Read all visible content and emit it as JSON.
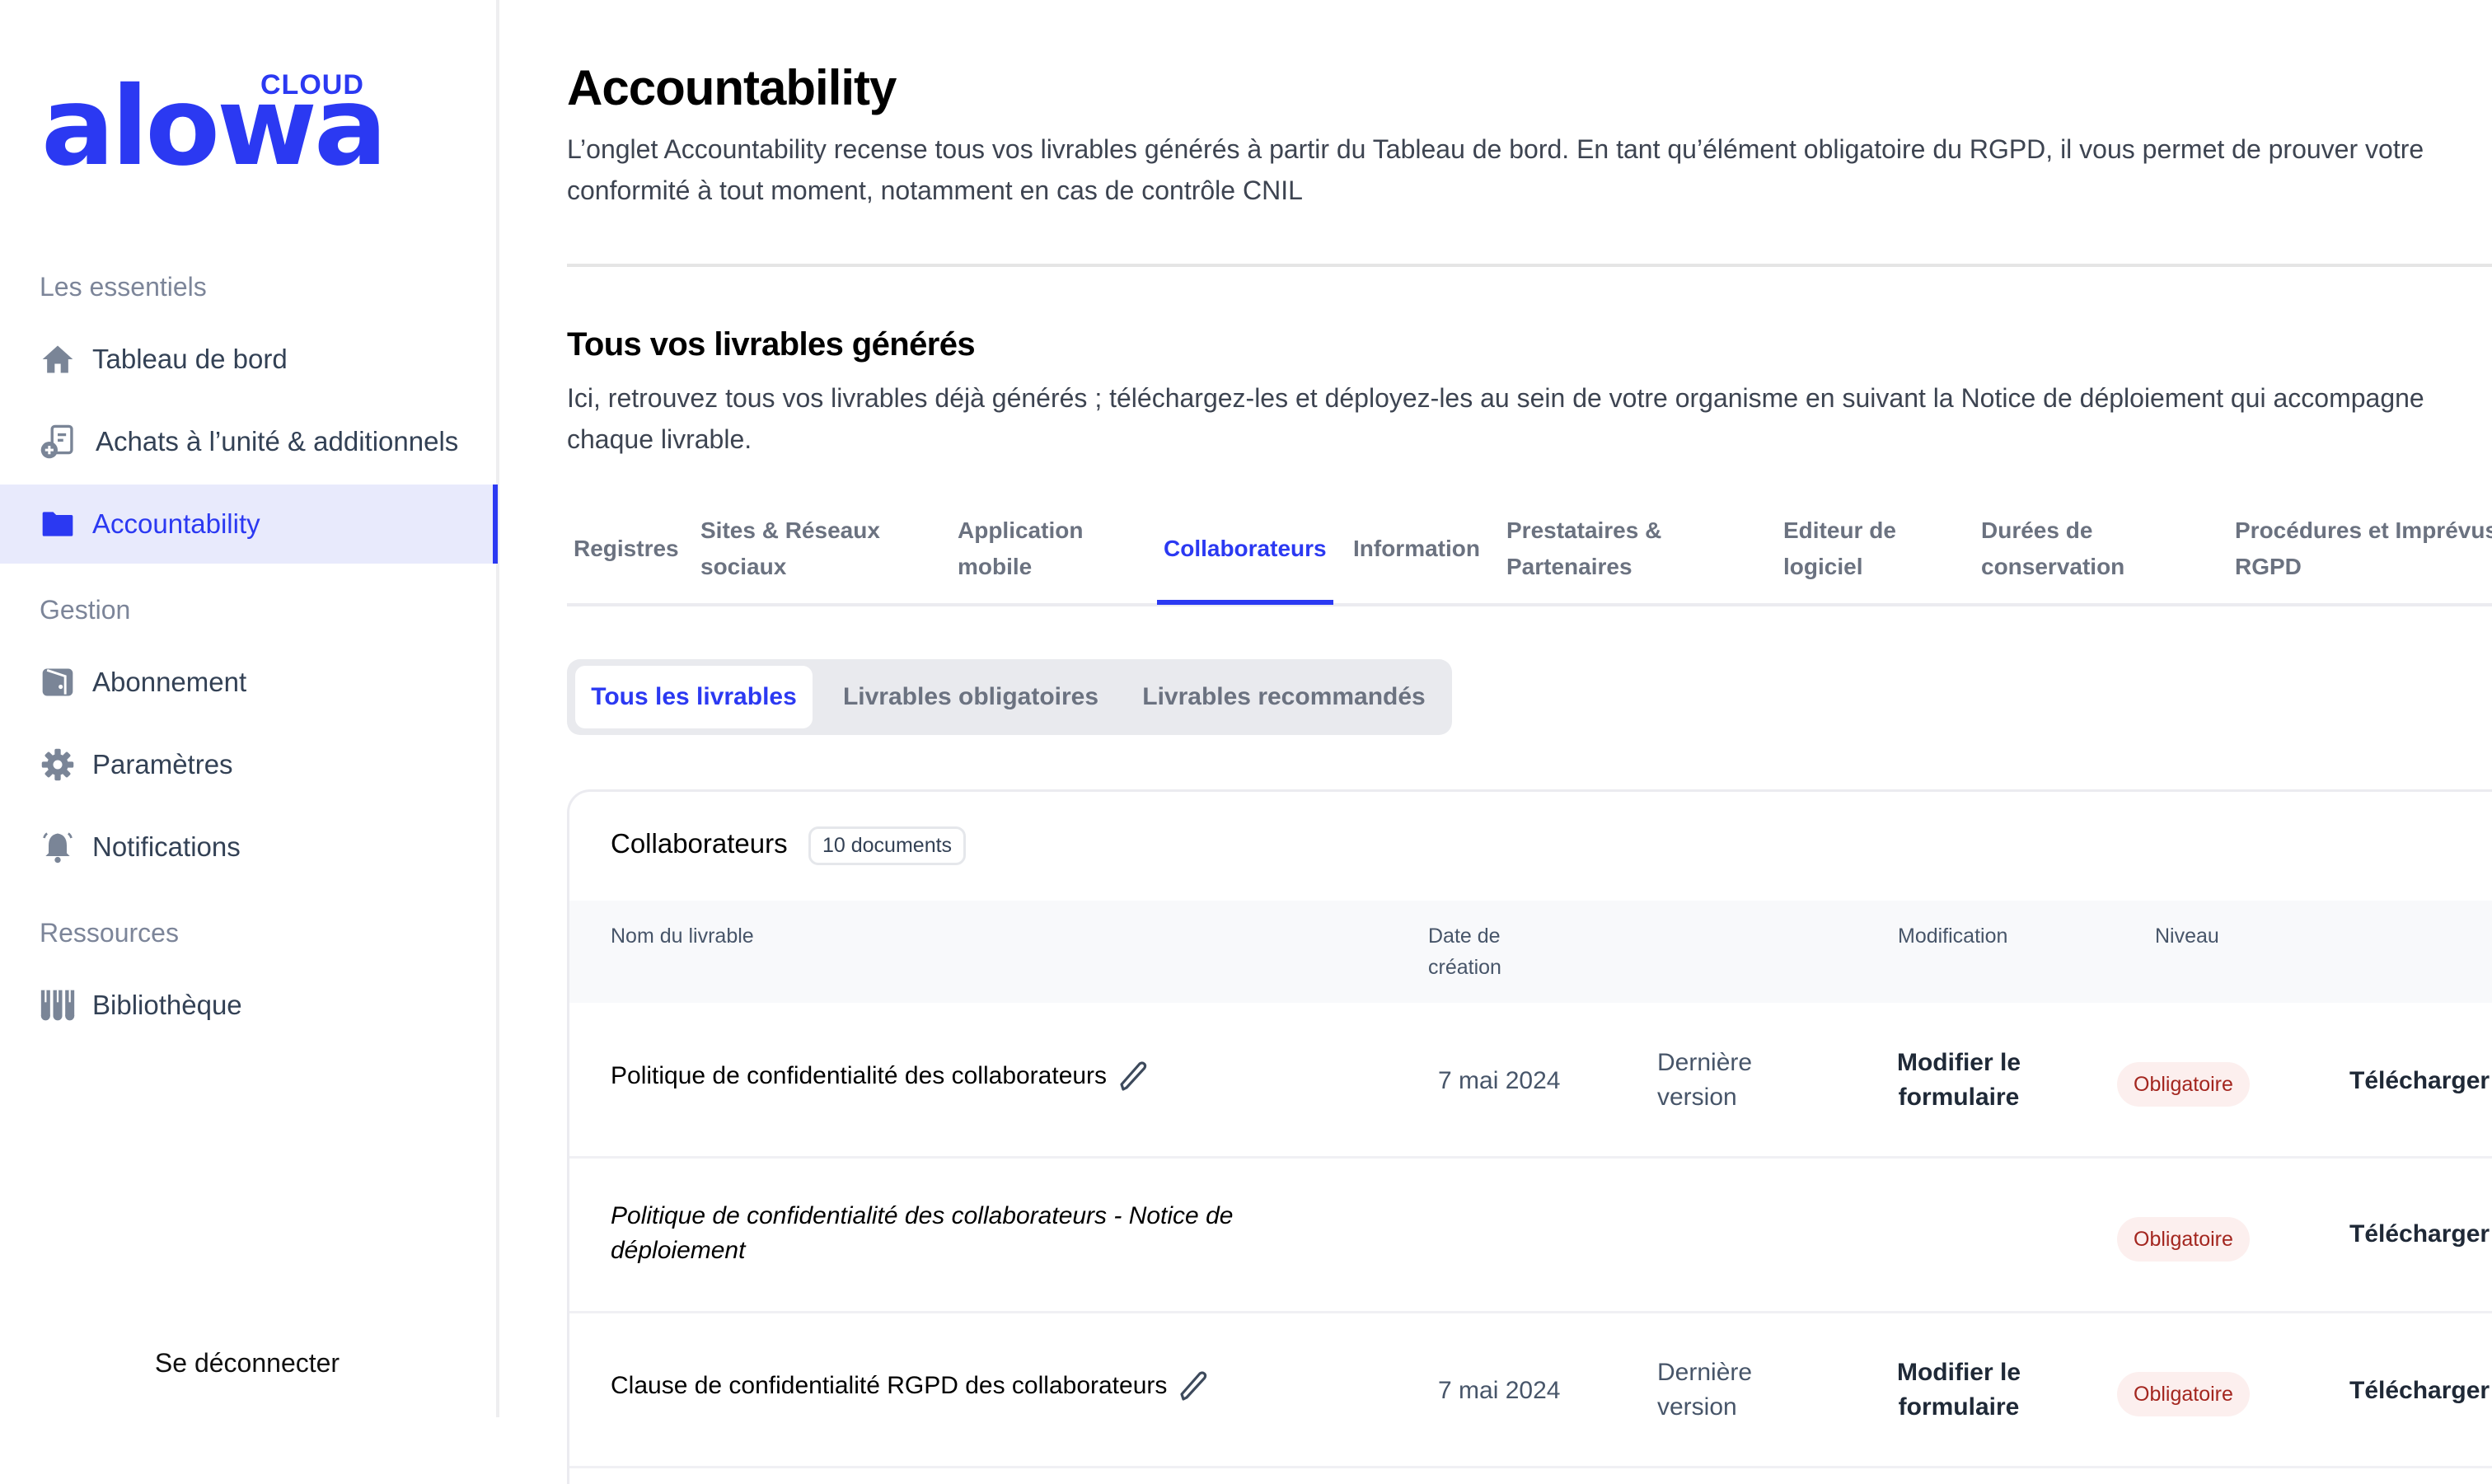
{
  "brand": {
    "name": "alowa",
    "suffix": "CLOUD",
    "accent": "#2b39f2"
  },
  "sidebar": {
    "sections": [
      {
        "title": "Les essentiels",
        "items": [
          {
            "label": "Tableau de bord",
            "icon": "home-icon"
          },
          {
            "label": "Achats à l’unité & additionnels",
            "icon": "document-add-icon"
          },
          {
            "label": "Accountability",
            "icon": "folder-icon",
            "active": true
          }
        ]
      },
      {
        "title": "Gestion",
        "items": [
          {
            "label": "Abonnement",
            "icon": "wallet-icon"
          },
          {
            "label": "Paramètres",
            "icon": "gear-icon"
          },
          {
            "label": "Notifications",
            "icon": "bell-icon"
          }
        ]
      },
      {
        "title": "Ressources",
        "items": [
          {
            "label": "Bibliothèque",
            "icon": "library-icon"
          }
        ]
      }
    ],
    "logout": "Se déconnecter"
  },
  "page": {
    "title": "Accountability",
    "intro": "L’onglet Accountability recense tous vos livrables générés à partir du Tableau de bord. En tant qu’élément obligatoire du RGPD, il vous permet de prouver votre conformité à tout moment, notamment en cas de contrôle CNIL",
    "section_title": "Tous vos livrables générés",
    "section_sub": "Ici, retrouvez tous vos livrables déjà générés ; téléchargez-les et déployez-les au sein de votre organisme en suivant la Notice de déploiement qui accompagne chaque livrable."
  },
  "tabs": [
    {
      "label": "Registres"
    },
    {
      "label": "Sites & Réseaux sociaux"
    },
    {
      "label": "Application mobile"
    },
    {
      "label": "Collaborateurs",
      "active": true
    },
    {
      "label": "Information"
    },
    {
      "label": "Prestataires & Partenaires"
    },
    {
      "label": "Editeur de logiciel"
    },
    {
      "label": "Durées de conservation"
    },
    {
      "label": "Procédures et Imprévus RGPD"
    }
  ],
  "filters": [
    {
      "label": "Tous les livrables",
      "active": true
    },
    {
      "label": "Livrables obligatoires"
    },
    {
      "label": "Livrables recommandés"
    }
  ],
  "table": {
    "title": "Collaborateurs",
    "count": "10 documents",
    "headers": {
      "name": "Nom du livrable",
      "date": "Date de création",
      "modification": "Modification",
      "level": "Niveau"
    },
    "rows": [
      {
        "name": "Politique de confidentialité des collaborateurs",
        "editable": true,
        "date": "7 mai 2024",
        "version": "Dernière version",
        "modify": "Modifier le formulaire",
        "level": "Obligatoire",
        "download": "Télécharger"
      },
      {
        "name": "Politique de confidentialité des collaborateurs - Notice de déploiement",
        "italic": true,
        "level": "Obligatoire",
        "download": "Télécharger"
      },
      {
        "name": "Clause de confidentialité RGPD des collaborateurs",
        "editable": true,
        "date": "7 mai 2024",
        "version": "Dernière version",
        "modify": "Modifier le formulaire",
        "level": "Obligatoire",
        "download": "Télécharger"
      }
    ]
  }
}
